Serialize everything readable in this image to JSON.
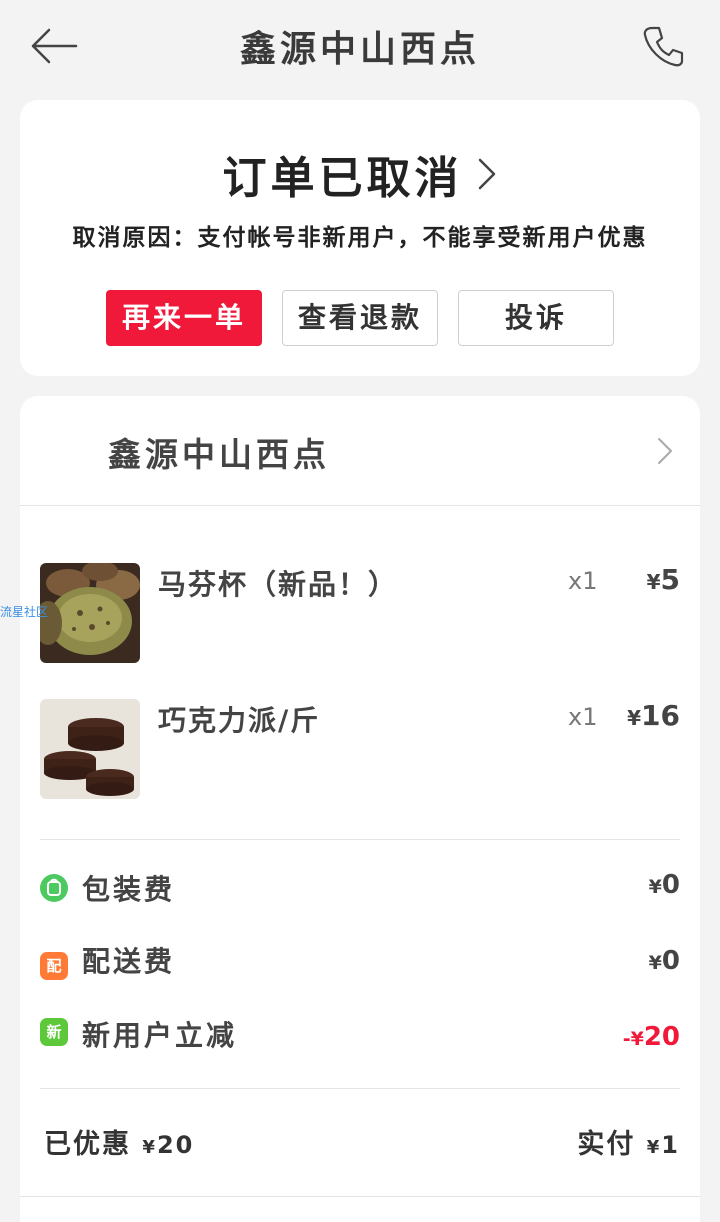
{
  "header": {
    "title": "鑫源中山西点",
    "back_icon": "arrow-left-icon",
    "phone_icon": "phone-icon"
  },
  "status": {
    "title": "订单已取消",
    "reason": "取消原因：支付帐号非新用户，不能享受新用户优惠",
    "buttons": {
      "reorder": "再来一单",
      "refund": "查看退款",
      "complain": "投诉"
    }
  },
  "order": {
    "shop_name": "鑫源中山西点",
    "items": [
      {
        "name": "马芬杯（新品！）",
        "qty": "x1",
        "currency": "¥",
        "price": "5",
        "thumb": "muffin-image"
      },
      {
        "name": "巧克力派/斤",
        "qty": "x1",
        "currency": "¥",
        "price": "16",
        "thumb": "chocolate-pie-image"
      }
    ],
    "fees": [
      {
        "icon_text": "",
        "icon": "bag-icon",
        "icon_color": "#4cc95f",
        "label": "包装费",
        "currency": "¥",
        "amount": "0"
      },
      {
        "icon_text": "配",
        "icon": "delivery-icon",
        "icon_color": "#ff7a35",
        "label": "配送费",
        "currency": "¥",
        "amount": "0"
      },
      {
        "icon_text": "新",
        "icon": "new-user-icon",
        "icon_color": "#5ec83b",
        "label": "新用户立减",
        "currency": "-¥",
        "amount": "20"
      }
    ],
    "summary": {
      "saved_label": "已优惠",
      "saved_currency": "¥",
      "saved_amount": "20",
      "paid_label": "实付",
      "paid_currency": "¥",
      "paid_amount": "1"
    }
  },
  "watermark": "流星社区",
  "colors": {
    "accent": "#f0193a",
    "background": "#f3f3f3"
  }
}
